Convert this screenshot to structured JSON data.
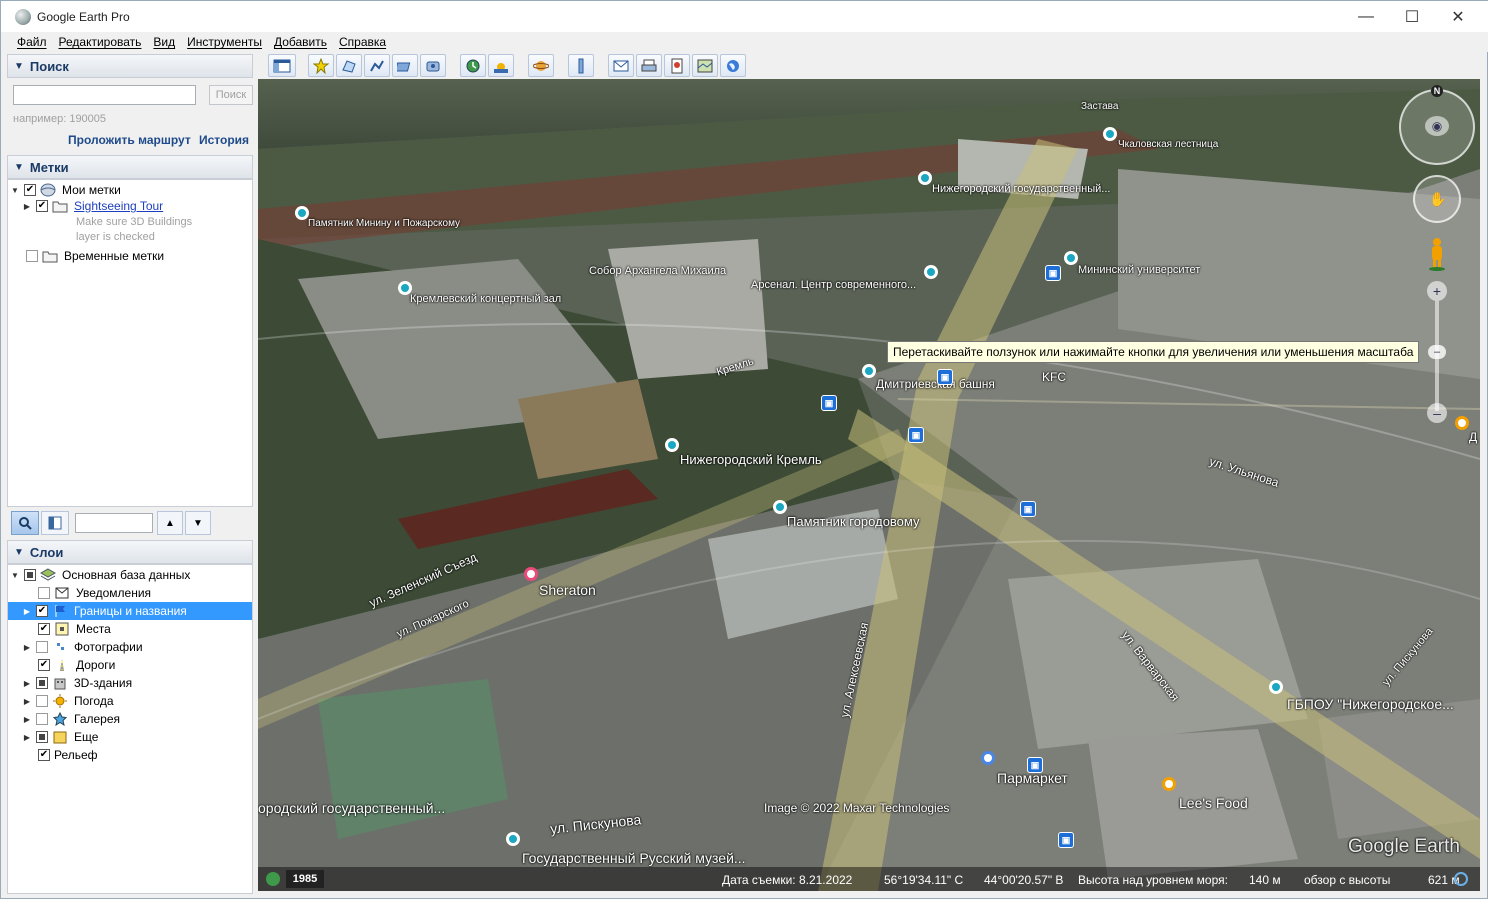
{
  "window": {
    "title": "Google Earth Pro",
    "minimize": "—",
    "maximize": "☐",
    "close": "✕"
  },
  "menu": [
    "Файл",
    "Редактировать",
    "Вид",
    "Инструменты",
    "Добавить",
    "Справка"
  ],
  "search": {
    "header": "Поиск",
    "input_value": "",
    "button": "Поиск",
    "hint": "например: 190005",
    "route_link": "Проложить маршрут",
    "history_link": "История"
  },
  "places": {
    "header": "Метки",
    "items": [
      {
        "label": "Мои метки",
        "checked": true
      },
      {
        "label": "Sightseeing Tour",
        "checked": true,
        "note_line1": "Make sure 3D Buildings",
        "note_line2": "layer is checked"
      },
      {
        "label": "Временные метки",
        "checked": false
      }
    ]
  },
  "layers": {
    "header": "Слои",
    "items": [
      {
        "label": "Основная база данных",
        "state": "partial"
      },
      {
        "label": "Уведомления",
        "state": "off"
      },
      {
        "label": "Границы и названия",
        "state": "on",
        "selected": true
      },
      {
        "label": "Места",
        "state": "on"
      },
      {
        "label": "Фотографии",
        "state": "off"
      },
      {
        "label": "Дороги",
        "state": "on"
      },
      {
        "label": "3D-здания",
        "state": "partial"
      },
      {
        "label": "Погода",
        "state": "off"
      },
      {
        "label": "Галерея",
        "state": "off"
      },
      {
        "label": "Еще",
        "state": "partial"
      },
      {
        "label": "Рельеф",
        "state": "on"
      }
    ]
  },
  "map_labels": {
    "zastava": "Застава",
    "chkalov": "Чкаловская лестница",
    "univ": "Нижегородский государственный...",
    "minin_monument": "Памятник Минину и Пожарскому",
    "sobor": "Собор Архангела Михаила",
    "arsenal": "Арсенал. Центр современного...",
    "minin_univ": "Мининский университет",
    "concert": "Кремлевский концертный зал",
    "kreml": "Кремль",
    "dmitr": "Дмитриевская башня",
    "kfc": "KFC",
    "nn_kreml": "Нижегородский Кремль",
    "gorodovoy": "Памятник городовому",
    "ulyanova": "ул. Ульянова",
    "zelensky": "ул. Зеленский Съезд",
    "pozharsk": "ул. Пожарского",
    "sheraton": "Sheraton",
    "alekseev": "ул. Алексеевская",
    "varvar": "ул. Варварская",
    "piskunova_r": "ул. Пискунова",
    "gbpou": "ГБПОУ \"Нижегородское...",
    "parmarket": "Пармаркет",
    "leesfood": "Lee's Food",
    "gos_univ_bottom": "ородский государственный...",
    "copyright": "Image © 2022 Maxar Technologies",
    "piskunova": "ул. Пискунова",
    "museum": "Государственный Русский музей...",
    "logo": "Google Earth",
    "e_label": "Д"
  },
  "tooltip": "Перетаскивайте ползунок или нажимайте кнопки для увеличения или уменьшения масштаба",
  "compass_n": "N",
  "status": {
    "year": "1985",
    "date": "Дата съемки: 8.21.2022",
    "lat": "56°19'34.11\" С",
    "lon": "44°00'20.57\" В",
    "elev_label": "Высота над уровнем моря:",
    "elev_value": "140 м",
    "eye_label": "обзор с высоты",
    "eye_value": "621 м"
  },
  "colors": {
    "accent_selected": "#3399ff",
    "header_text": "#1a3a66",
    "link": "#1e4a8a"
  }
}
